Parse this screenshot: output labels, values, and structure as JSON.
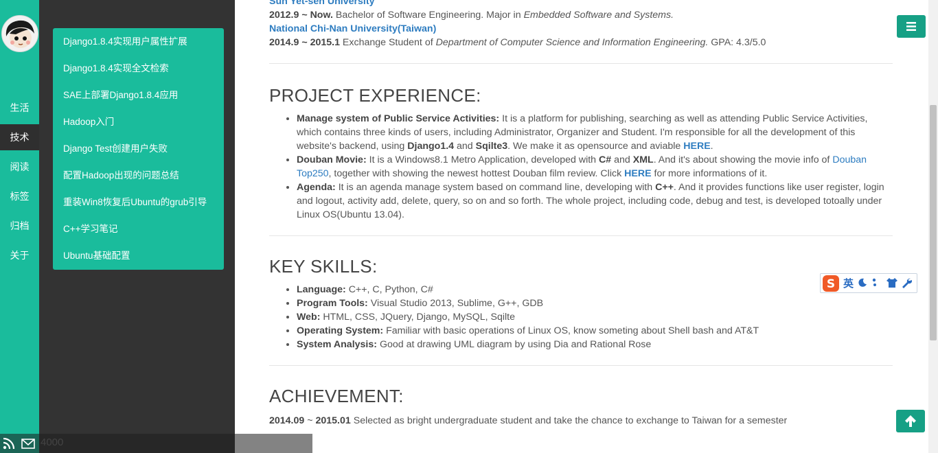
{
  "nav": {
    "items": [
      {
        "label": "生活"
      },
      {
        "label": "技术"
      },
      {
        "label": "阅读"
      },
      {
        "label": "标签"
      },
      {
        "label": "归档"
      },
      {
        "label": "关于"
      }
    ],
    "active": "技术"
  },
  "submenu": {
    "items": [
      "Django1.8.4实现用户属性扩展",
      "Django1.8.4实现全文检索",
      "SAE上部署Django1.8.4应用",
      "Hadoop入门",
      "Django Test创建用户失败",
      "配置Hadoop出现的问题总结",
      "重装Win8恢复后Ubuntu的grub引导",
      "C++学习笔记",
      "Ubuntu基础配置"
    ]
  },
  "footer": {
    "visits": "4000"
  },
  "education": {
    "uni1_name": "Sun Yet-sen University",
    "uni1_period": "2012.9 ~ Now.",
    "uni1_text": "Bachelor of Software Engineering. Major in",
    "uni1_major": "Embedded Software and Systems.",
    "uni2_name": "National Chi-Nan University(Taiwan)",
    "uni2_period": "2014.9 ~ 2015.1",
    "uni2_text": "Exchange Student of",
    "uni2_dept": "Department of Computer Science and Information Engineering.",
    "uni2_gpa": "GPA: 4.3/5.0"
  },
  "project": {
    "heading": "PROJECT EXPERIENCE:",
    "p1_title": "Manage system of Public Service Activities:",
    "p1_text1": "It is a platform for publishing, searching as well as attending Public Service Activities, which contains three kinds of users, including Administrator, Organizer and Student. I'm responsible for all the development of this website's backend, using",
    "p1_tech1": "Django1.4",
    "p1_and": "and",
    "p1_tech2": "Sqilte3",
    "p1_text2": ". We make it as opensource and aviable",
    "p1_link": "HERE",
    "p1_end": ".",
    "p2_title": "Douban Movie:",
    "p2_text1": "It is a Windows8.1 Metro Application, developed with",
    "p2_tech1": "C#",
    "p2_and": "and",
    "p2_tech2": "XML",
    "p2_text2": ". And it's about showing the movie info of",
    "p2_link1": "Douban Top250",
    "p2_text3": ", together with showing the newest hottest Douban film review. Click",
    "p2_link2": "HERE",
    "p2_text4": "for more informations of it.",
    "p3_title": "Agenda:",
    "p3_text1": "It is an agenda manage system based on command line, developing with",
    "p3_tech": "C++",
    "p3_text2": ". And it provides functions like user register, login and logout, activity add, delete, query, so on and so forth. The whole project, including code, debug and test, is developed totoally under Linux OS(Ubuntu 13.04)."
  },
  "skills": {
    "heading": "KEY SKILLS:",
    "items": [
      {
        "label": "Language:",
        "value": "C++, C, Python, C#"
      },
      {
        "label": "Program Tools:",
        "value": "Visual Studio 2013, Sublime, G++, GDB"
      },
      {
        "label": "Web:",
        "value": "HTML, CSS, JQuery, Django, MySQL, Sqilte"
      },
      {
        "label": "Operating System:",
        "value": "Familiar with basic operations of Linux OS, know someting about Shell bash and AT&T"
      },
      {
        "label": "System Analysis:",
        "value": "Good at drawing UML diagram by using Dia and Rational Rose"
      }
    ]
  },
  "achievement": {
    "heading": "ACHIEVEMENT:",
    "a1_from": "2014.09",
    "a1_sep": "~",
    "a1_to": "2015.01",
    "a1_text": "Selected as bright undergraduate student and take the chance to exchange to Taiwan for a semester"
  },
  "ime": {
    "lang": "英"
  },
  "colors": {
    "accent": "#1abc9c",
    "dark": "#333333",
    "link": "#2d7cc0",
    "fab": "#16a085"
  }
}
